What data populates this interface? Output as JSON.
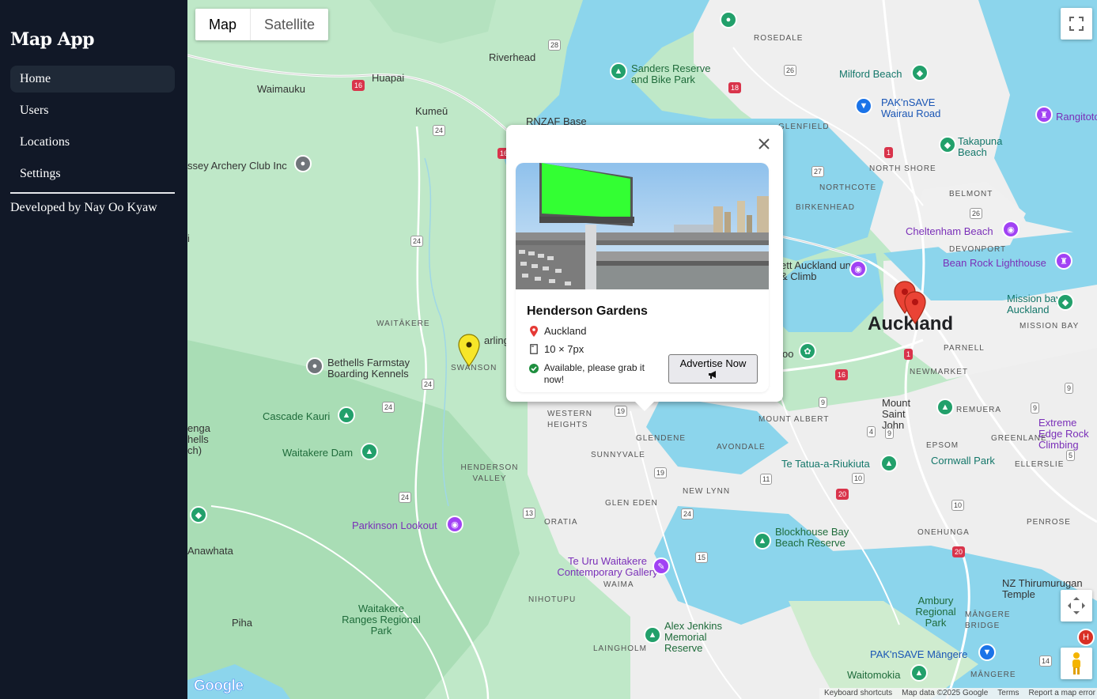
{
  "sidebar": {
    "brand": "Map App",
    "nav": [
      "Home",
      "Users",
      "Locations",
      "Settings"
    ],
    "active": "Home",
    "credit": "Developed by Nay Oo Kyaw"
  },
  "map_controls": {
    "map_label": "Map",
    "satellite_label": "Satellite",
    "selected": "Map"
  },
  "map_labels": {
    "places": [
      "Riverhead",
      "Huapai",
      "Waimauku",
      "Kumeū",
      "RNZAF Base",
      "ROSEDALE",
      "GLENFIELD",
      "Milford Beach",
      "PAK'nSAVE Wairau Road",
      "Rangitoto",
      "Takapuna Beach",
      "NORTH SHORE",
      "NORTHCOTE",
      "BELMONT",
      "BIRKENHEAD",
      "DEVONPORT",
      "Cheltenham Beach",
      "Bean Rock Lighthouse",
      "Mission bay Auckland",
      "MISSION BAY",
      "Auckland",
      "PARNELL",
      "NEWMARKET",
      "REMUERA",
      "Mount Saint John",
      "MOUNT ALBERT",
      "AVONDALE",
      "GLENDENE",
      "SUNNYVALE",
      "GLEN EDEN",
      "NEW LYNN",
      "EPSOM",
      "GREENLANE",
      "Extreme Edge Rock Climbing",
      "ELLERSLIE",
      "Cornwall Park",
      "Te Tatua-a-Riukiuta",
      "ONEHUNGA",
      "PENROSE",
      "Sanders Reserve and Bike Park",
      "ssey Archery Club Inc",
      "WAITĀKERE",
      "Bethells Farmstay Boarding Kennels",
      "SWANSON",
      "Cascade Kauri",
      "Waitakere Dam",
      "HENDERSON VALLEY",
      "WESTERN HEIGHTS",
      "Parkinson Lookout",
      "ORATIA",
      "Te Uru Waitakere Contemporary Gallery",
      "WAIMA",
      "NIHOTUPU",
      "Waitakere Ranges Regional Park",
      "Alex Jenkins Memorial Reserve",
      "LAINGHOLM",
      "Blockhouse Bay Beach Reserve",
      "Anawhata",
      "Piha",
      "Ambury Regional Park",
      "MĀNGERE BRIDGE",
      "PAK'nSAVE Māngere",
      "Waitomokia",
      "MĀNGERE",
      "NZ Thirumurugan Temple",
      "ett Auckland ungy & Climb",
      "oo",
      "arling",
      "enga hells ch)",
      "i"
    ]
  },
  "attribution": {
    "shortcuts": "Keyboard shortcuts",
    "data": "Map data ©2025 Google",
    "terms": "Terms",
    "report": "Report a map error",
    "logo": "Google"
  },
  "info_window": {
    "title": "Henderson Gardens",
    "location": "Auckland",
    "size": "10 × 7px",
    "status": "Available, please grab it now!",
    "cta": "Advertise Now"
  },
  "colors": {
    "sidebar_bg": "#111827",
    "billboard": "#33ff33",
    "pin_red": "#ea4335",
    "pin_yellow": "#f7e628"
  }
}
